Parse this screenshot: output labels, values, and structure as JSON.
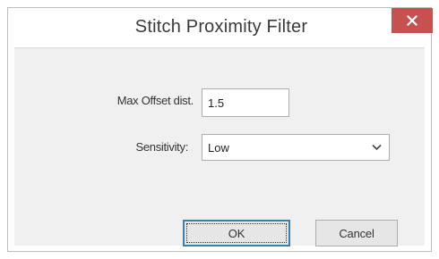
{
  "dialog": {
    "title": "Stitch Proximity Filter",
    "close_icon": "close-icon",
    "close_color": "#c75050"
  },
  "form": {
    "max_offset_label": "Max Offset dist.",
    "max_offset_value": "1.5",
    "sensitivity_label": "Sensitivity:",
    "sensitivity_value": "Low",
    "dropdown_icon": "chevron-down-icon"
  },
  "buttons": {
    "ok_label": "OK",
    "cancel_label": "Cancel"
  }
}
